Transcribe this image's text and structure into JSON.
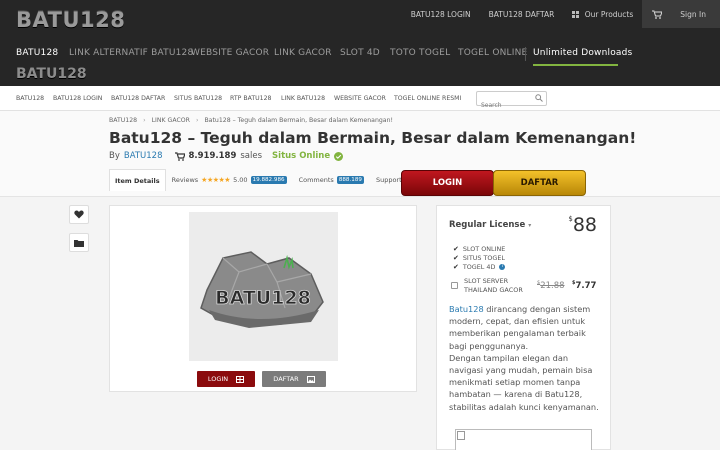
{
  "brand": {
    "logo_text": "BATU128",
    "logo_text_small": "BATU128"
  },
  "toplinks": {
    "login": "BATU128 LOGIN",
    "daftar": "BATU128 DAFTAR",
    "products": "Our Products",
    "signin": "Sign In"
  },
  "nav": {
    "items": [
      "BATU128",
      "LINK ALTERNATIF BATU128",
      "WEBSITE GACOR",
      "LINK GACOR",
      "SLOT 4D",
      "TOTO TOGEL",
      "TOGEL ONLINE",
      "Unlimited Downloads"
    ]
  },
  "subnav": {
    "items": [
      "BATU128",
      "BATU128 LOGIN",
      "BATU128 DAFTAR",
      "SITUS BATU128",
      "RTP BATU128",
      "LINK BATU128",
      "WEBSITE GACOR",
      "TOGEL ONLINE RESMI"
    ],
    "search_placeholder": "Search"
  },
  "breadcrumb": [
    "BATU128",
    "LINK GACOR",
    "Batu128 – Teguh dalam Bermain, Besar dalam Kemenangan!"
  ],
  "page": {
    "title": "Batu128 – Teguh dalam Bermain, Besar dalam Kemenangan!",
    "by_label": "By",
    "author": "BATU128",
    "sales_count": "8.919.189",
    "sales_label": "sales",
    "status": "Situs Online"
  },
  "tabs": {
    "item_details": "Item Details",
    "reviews_label": "Reviews",
    "stars": "★★★★★",
    "rating": "5.00",
    "reviews_count": "19.882.986",
    "comments_label": "Comments",
    "comments_count": "888.189",
    "support_label": "Support"
  },
  "cta": {
    "login": "LOGIN",
    "daftar": "DAFTAR"
  },
  "preview": {
    "logo_text": "BATU128",
    "login_button": "LOGIN",
    "daftar_button": "DAFTAR"
  },
  "license": {
    "title": "Regular License",
    "currency": "$",
    "price": "88",
    "features": [
      "SLOT ONLINE",
      "SITUS TOGEL",
      "TOGEL 4D"
    ],
    "addon_line1": "SLOT SERVER",
    "addon_line2": "THAILAND GACOR",
    "addon_old_price": "21.88",
    "addon_new_price": "7.77",
    "desc_link": "Batu128",
    "desc_p1": " dirancang dengan sistem modern, cepat, dan efisien untuk memberikan pengalaman terbaik bagi penggunanya.",
    "desc_p2": "Dengan tampilan elegan dan navigasi yang mudah, pemain bisa menikmati setiap momen tanpa hambatan — karena di Batu128, stabilitas adalah kunci kenyamanan."
  },
  "colors": {
    "dark_bar": "#262626",
    "accent_green": "#82b440",
    "link_blue": "#2a7ab0",
    "login_red": "#c0171f",
    "daftar_gold": "#f3c12a"
  }
}
